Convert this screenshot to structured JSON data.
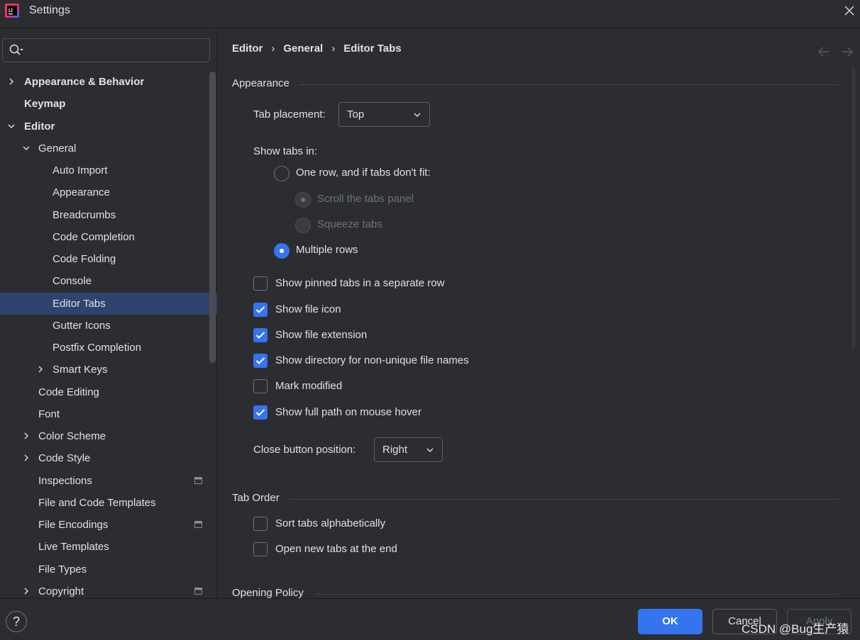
{
  "window": {
    "title": "Settings"
  },
  "search": {
    "value": "",
    "placeholder": ""
  },
  "sidebar": {
    "items": [
      {
        "label": "Appearance & Behavior"
      },
      {
        "label": "Keymap"
      },
      {
        "label": "Editor"
      },
      {
        "label": "General"
      },
      {
        "label": "Auto Import"
      },
      {
        "label": "Appearance"
      },
      {
        "label": "Breadcrumbs"
      },
      {
        "label": "Code Completion"
      },
      {
        "label": "Code Folding"
      },
      {
        "label": "Console"
      },
      {
        "label": "Editor Tabs"
      },
      {
        "label": "Gutter Icons"
      },
      {
        "label": "Postfix Completion"
      },
      {
        "label": "Smart Keys"
      },
      {
        "label": "Code Editing"
      },
      {
        "label": "Font"
      },
      {
        "label": "Color Scheme"
      },
      {
        "label": "Code Style"
      },
      {
        "label": "Inspections"
      },
      {
        "label": "File and Code Templates"
      },
      {
        "label": "File Encodings"
      },
      {
        "label": "Live Templates"
      },
      {
        "label": "File Types"
      },
      {
        "label": "Copyright"
      }
    ],
    "selected": "Editor Tabs"
  },
  "breadcrumb": {
    "items": [
      "Editor",
      "General",
      "Editor Tabs"
    ],
    "separator": "›"
  },
  "appearance": {
    "section_title": "Appearance",
    "tab_placement_label": "Tab placement:",
    "tab_placement_value": "Top",
    "show_tabs_in_label": "Show tabs in:",
    "radio_one_row": "One row, and if tabs don't fit:",
    "radio_scroll": "Scroll the tabs panel",
    "radio_squeeze": "Squeeze tabs",
    "radio_multiple": "Multiple rows",
    "check_pinned": "Show pinned tabs in a separate row",
    "check_file_icon": "Show file icon",
    "check_file_ext": "Show file extension",
    "check_directory": "Show directory for non-unique file names",
    "check_mark_modified": "Mark modified",
    "check_full_path": "Show full path on mouse hover",
    "close_button_label": "Close button position:",
    "close_button_value": "Right"
  },
  "tab_order": {
    "section_title": "Tab Order",
    "check_sort": "Sort tabs alphabetically",
    "check_open_end": "Open new tabs at the end"
  },
  "opening_policy": {
    "section_title": "Opening Policy"
  },
  "footer": {
    "help_label": "?",
    "ok_label": "OK",
    "cancel_label": "Cancel",
    "apply_label": "Apply",
    "watermark": "CSDN @Bug生产猿"
  },
  "colors": {
    "background": "#2b2d30",
    "accent": "#3574f0",
    "selection": "#2e436e",
    "text": "#dfe1e5",
    "disabled_text": "#6f737a"
  }
}
